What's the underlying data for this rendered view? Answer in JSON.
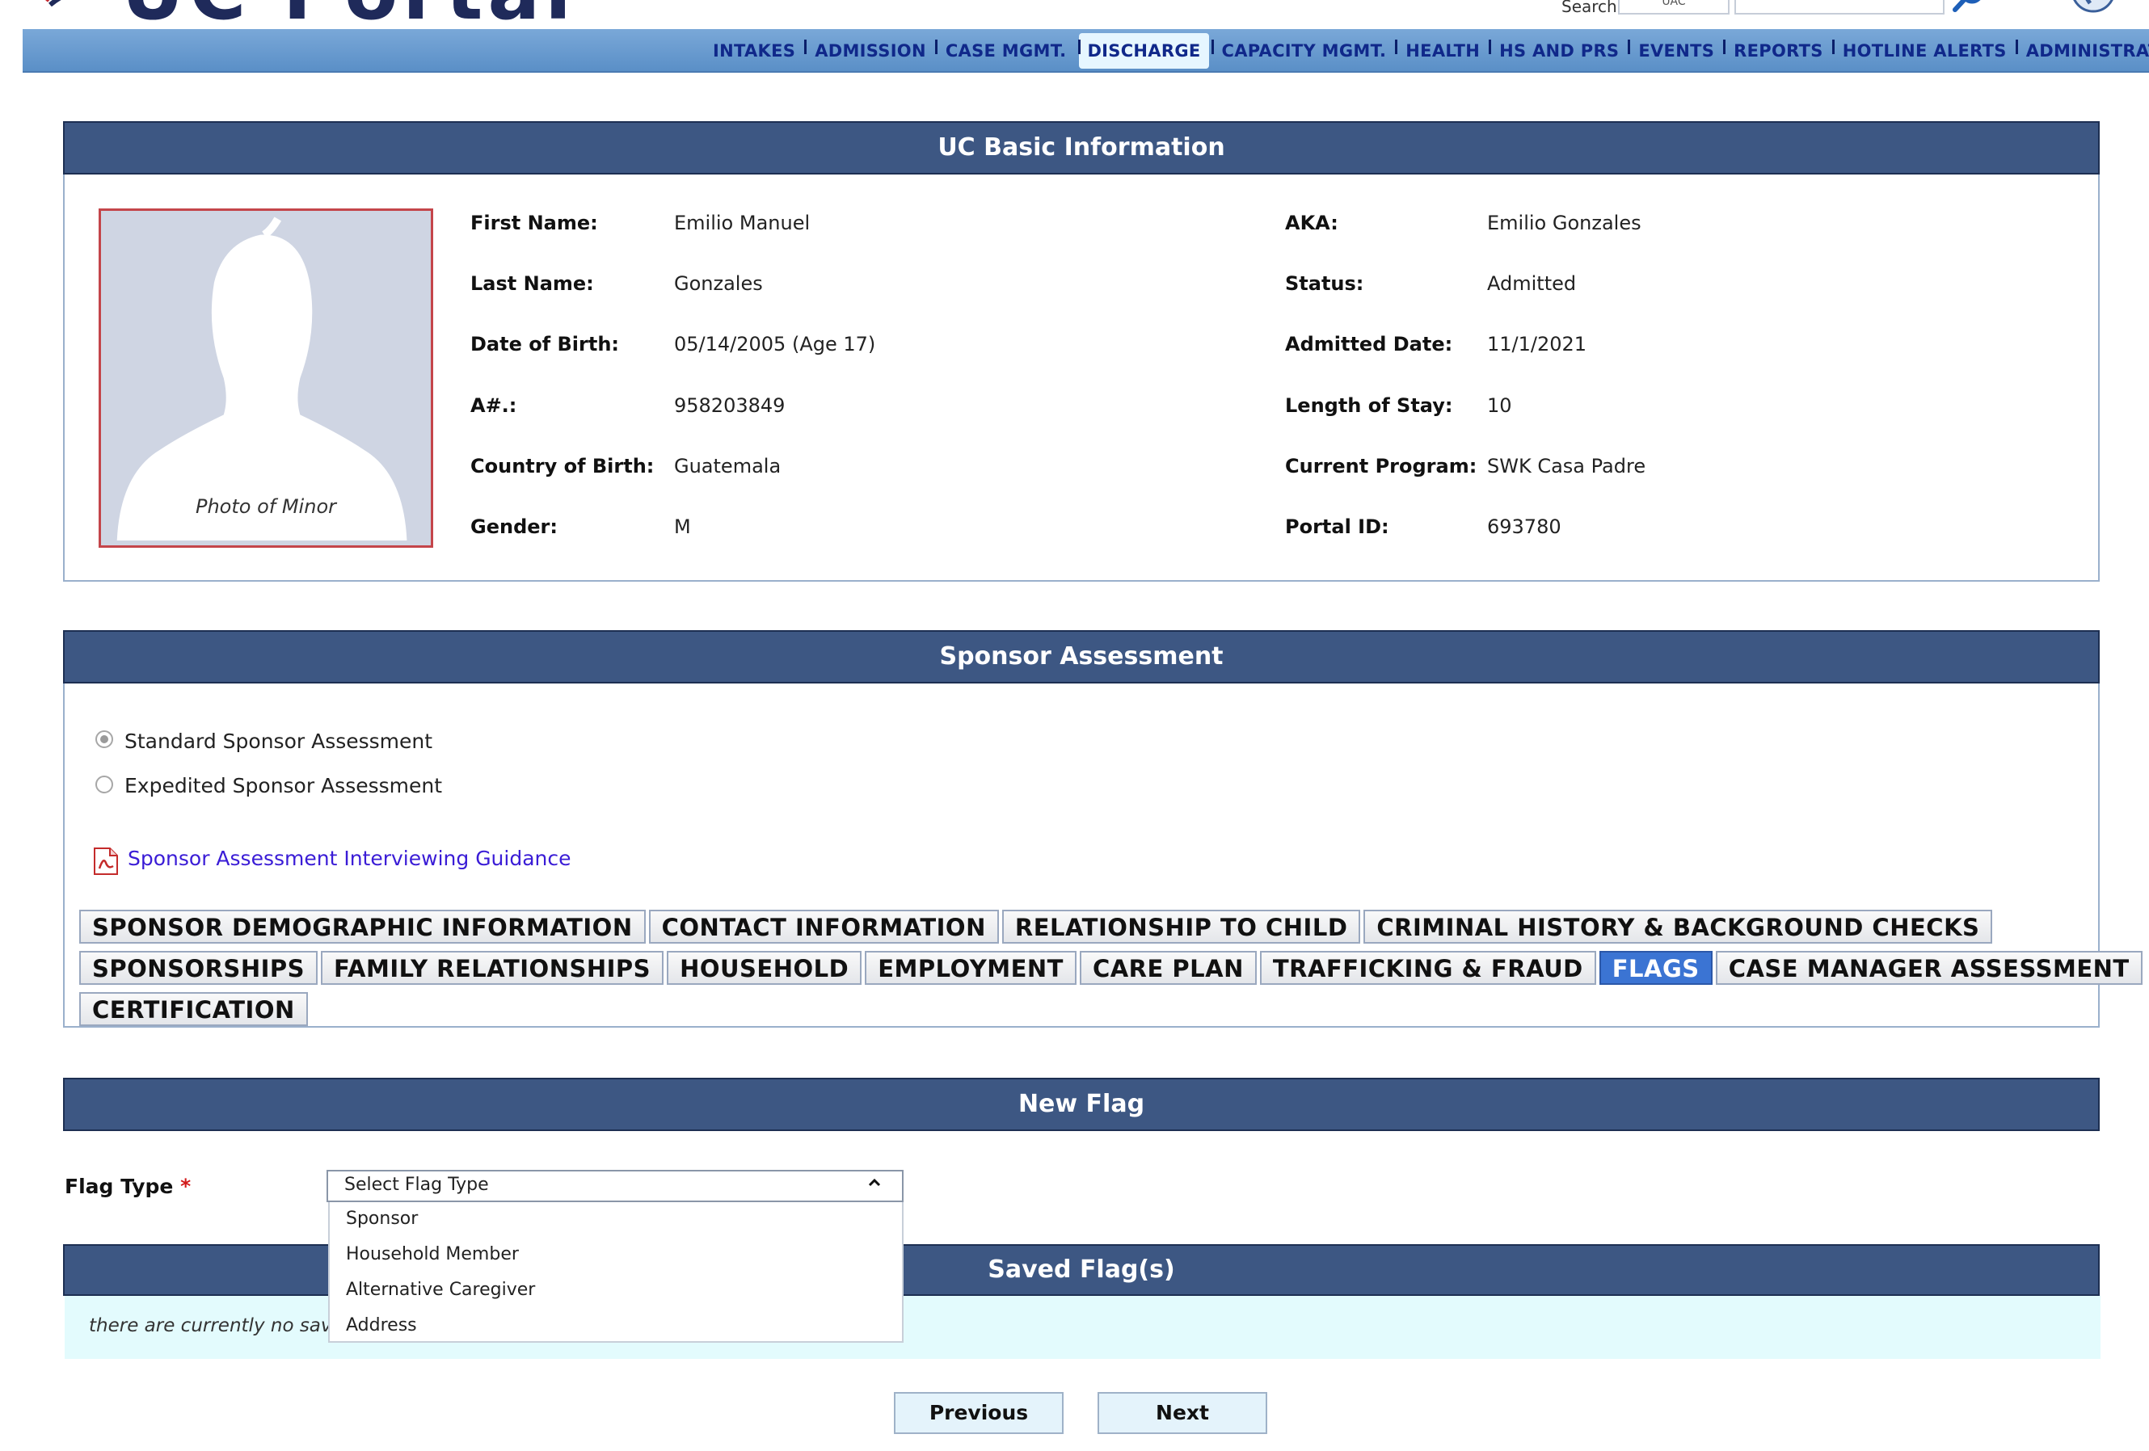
{
  "header": {
    "app_title": "UC Portal",
    "search_label": "Search",
    "search_scope": "UAC",
    "search_value": ""
  },
  "nav": {
    "items": [
      "INTAKES",
      "ADMISSION",
      "CASE MGMT.",
      "DISCHARGE",
      "CAPACITY MGMT.",
      "HEALTH",
      "HS AND PRS",
      "EVENTS",
      "REPORTS",
      "HOTLINE ALERTS",
      "ADMINISTRATION"
    ],
    "active": "DISCHARGE"
  },
  "basic_info": {
    "title": "UC Basic Information",
    "photo_caption": "Photo of Minor",
    "left": [
      {
        "label": "First Name:",
        "value": "Emilio Manuel"
      },
      {
        "label": "Last Name:",
        "value": "Gonzales"
      },
      {
        "label": "Date of Birth:",
        "value": "05/14/2005 (Age 17)"
      },
      {
        "label": "A#.:",
        "value": "958203849"
      },
      {
        "label": "Country of Birth:",
        "value": "Guatemala"
      },
      {
        "label": "Gender:",
        "value": "M"
      }
    ],
    "right": [
      {
        "label": "AKA:",
        "value": "Emilio Gonzales"
      },
      {
        "label": "Status:",
        "value": "Admitted"
      },
      {
        "label": "Admitted Date:",
        "value": "11/1/2021"
      },
      {
        "label": "Length of Stay:",
        "value": "10"
      },
      {
        "label": "Current Program:",
        "value": "SWK Casa Padre"
      },
      {
        "label": "Portal ID:",
        "value": "693780"
      }
    ]
  },
  "sponsor_assessment": {
    "title": "Sponsor Assessment",
    "options": [
      "Standard Sponsor Assessment",
      "Expedited Sponsor Assessment"
    ],
    "selected": "Standard Sponsor Assessment",
    "guidance_link": "Sponsor Assessment Interviewing Guidance",
    "tabs_row1": [
      "SPONSOR DEMOGRAPHIC INFORMATION",
      "CONTACT INFORMATION",
      "RELATIONSHIP TO CHILD",
      "CRIMINAL HISTORY & BACKGROUND CHECKS"
    ],
    "tabs_row2": [
      "SPONSORSHIPS",
      "FAMILY RELATIONSHIPS",
      "HOUSEHOLD",
      "EMPLOYMENT",
      "CARE PLAN",
      "TRAFFICKING & FRAUD",
      "FLAGS",
      "CASE MANAGER ASSESSMENT"
    ],
    "tabs_row3": [
      "CERTIFICATION"
    ],
    "active_tab": "FLAGS"
  },
  "new_flag": {
    "title": "New Flag",
    "flag_type_label": "Flag Type",
    "required_mark": "*",
    "select_placeholder": "Select Flag Type",
    "options": [
      "Sponsor",
      "Household Member",
      "Alternative Caregiver",
      "Address"
    ]
  },
  "saved_flags": {
    "title": "Saved Flag(s)",
    "empty_text": "there are currently no saved"
  },
  "buttons": {
    "previous": "Previous",
    "next": "Next"
  },
  "colors": {
    "section_header": "#3d5783",
    "nav_bar": "#6b9bd0",
    "active_tab": "#3b74d3",
    "link": "#3a1cd6",
    "required": "#d21b1b",
    "saved_empty_bg": "#e3fbfd"
  }
}
